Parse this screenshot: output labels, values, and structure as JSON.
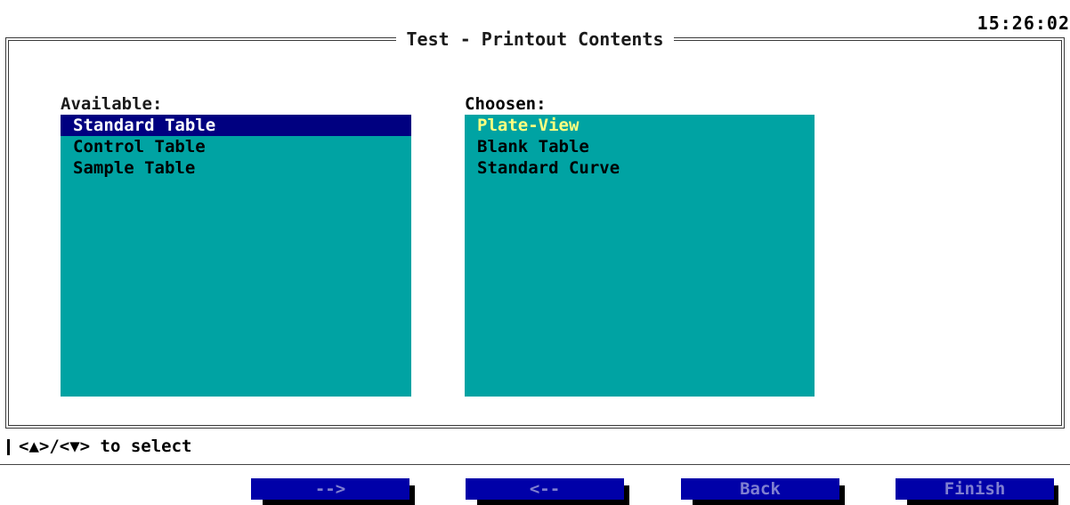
{
  "clock": "15:26:02",
  "dialog": {
    "title": "Test - Printout Contents"
  },
  "available": {
    "label": "Available:",
    "items": [
      "Standard Table",
      "Control Table",
      "Sample Table"
    ],
    "selected_index": 0
  },
  "chosen": {
    "label": "Choosen:",
    "items": [
      "Plate-View",
      "Blank Table",
      "Standard Curve"
    ],
    "highlighted_index": 0
  },
  "status": {
    "text": "<▲>/<▼> to select"
  },
  "buttons": {
    "add": "-->",
    "remove": "<--",
    "back": "Back",
    "finish": "Finish"
  },
  "colors": {
    "list_bg": "#00a3a3",
    "selection_bg": "#000080",
    "highlight_text": "#ffff7f",
    "button_bg": "#0000a8",
    "button_text": "#7f7fd0"
  }
}
